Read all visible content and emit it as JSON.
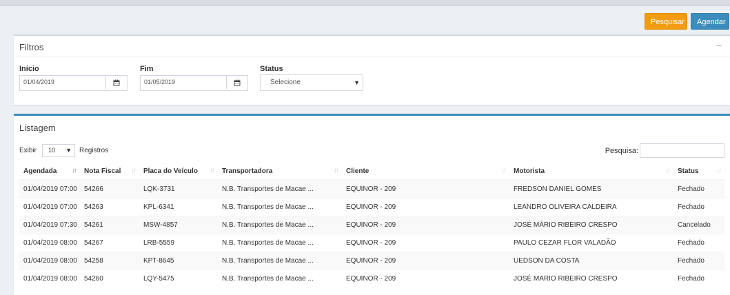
{
  "toolbar": {
    "pesquisar_label": "Pesquisar",
    "agendar_label": "Agendar"
  },
  "filtros": {
    "title": "Filtros",
    "inicio_label": "Início",
    "inicio_value": "01/04/2019",
    "fim_label": "Fim",
    "fim_value": "01/05/2019",
    "status_label": "Status",
    "status_value": "Selecione"
  },
  "listagem": {
    "title": "Listagem",
    "exibir_label": "Exibir",
    "page_size": "10",
    "registros_label": "Registros",
    "pesquisa_label": "Pesquisa:",
    "columns": [
      "Agendada",
      "Nota Fiscal",
      "Placa do Veículo",
      "Transportadora",
      "Cliente",
      "Motorista",
      "Status"
    ],
    "rows": [
      [
        "01/04/2019 07:00",
        "54266",
        "LQK-3731",
        "N.B. Transportes de Macae ...",
        "EQUINOR - 209",
        "FREDSON DANIEL GOMES",
        "Fechado"
      ],
      [
        "01/04/2019 07:00",
        "54263",
        "KPL-6341",
        "N.B. Transportes de Macae ...",
        "EQUINOR - 209",
        "LEANDRO OLIVEIRA CALDEIRA",
        "Fechado"
      ],
      [
        "01/04/2019 07:30",
        "54261",
        "MSW-4857",
        "N.B. Transportes de Macae ...",
        "EQUINOR - 209",
        "JOSÉ MÁRIO RIBEIRO CRESPO",
        "Cancelado"
      ],
      [
        "01/04/2019 08:00",
        "54267",
        "LRB-5559",
        "N.B. Transportes de Macae ...",
        "EQUINOR - 209",
        "PAULO CEZAR FLOR VALADÃO",
        "Fechado"
      ],
      [
        "01/04/2019 08:00",
        "54258",
        "KPT-8645",
        "N.B. Transportes de Macae ...",
        "EQUINOR - 209",
        "UEDSON DA COSTA",
        "Fechado"
      ],
      [
        "01/04/2019 08:00",
        "54260",
        "LQY-5475",
        "N.B. Transportes de Macae ...",
        "EQUINOR - 209",
        "JOSÉ MARIO RIBEIRO CRESPO",
        "Fechado"
      ]
    ]
  }
}
